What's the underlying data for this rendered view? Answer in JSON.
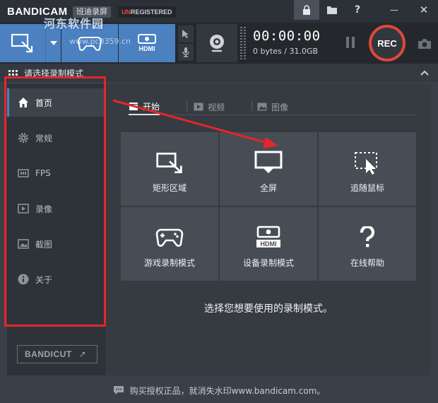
{
  "app": {
    "logo_main": "BANDI",
    "logo_cam": "CAM",
    "brand_badge": "班迪录屏",
    "unregistered_prefix": "UN",
    "unregistered_rest": "REGISTERED",
    "watermark": "河东软件园",
    "watermark_url": "www.pc0359.cn"
  },
  "titlebar": {
    "help_label": "?",
    "minimize_label": "—",
    "close_label": "✕"
  },
  "recorder": {
    "timer": "00:00:00",
    "size": "0 bytes / 31.0GB",
    "rec_label": "REC",
    "hdmi_label": "HDMI"
  },
  "mode_header": {
    "label": "请选择录制模式"
  },
  "sidebar": {
    "items": [
      {
        "label": "首页",
        "icon": "home-icon"
      },
      {
        "label": "常规",
        "icon": "gear-icon"
      },
      {
        "label": "FPS",
        "icon": "fps-icon"
      },
      {
        "label": "录像",
        "icon": "video-icon"
      },
      {
        "label": "截图",
        "icon": "image-icon"
      },
      {
        "label": "关于",
        "icon": "info-icon"
      }
    ],
    "bandicut_label": "BANDICUT",
    "bandicut_ext": "↗"
  },
  "tabs": [
    {
      "label": "开始"
    },
    {
      "label": "视频"
    },
    {
      "label": "图像"
    }
  ],
  "modes": [
    {
      "label": "矩形区域",
      "icon": "rectangle-area-icon"
    },
    {
      "label": "全屏",
      "icon": "fullscreen-monitor-icon"
    },
    {
      "label": "追随鼠标",
      "icon": "follow-mouse-icon"
    },
    {
      "label": "游戏录制模式",
      "icon": "gamepad-icon"
    },
    {
      "label": "设备录制模式",
      "icon": "hdmi-device-icon"
    },
    {
      "label": "在线帮助",
      "icon": "question-icon"
    }
  ],
  "main": {
    "hint": "选择您想要使用的录制模式。"
  },
  "footer": {
    "text": "购买授权正品，就消失水印www.bandicam.com。"
  },
  "colors": {
    "accent_blue": "#4b81c1",
    "rec_red": "#e0473a",
    "annotation_red": "#e4262a"
  }
}
